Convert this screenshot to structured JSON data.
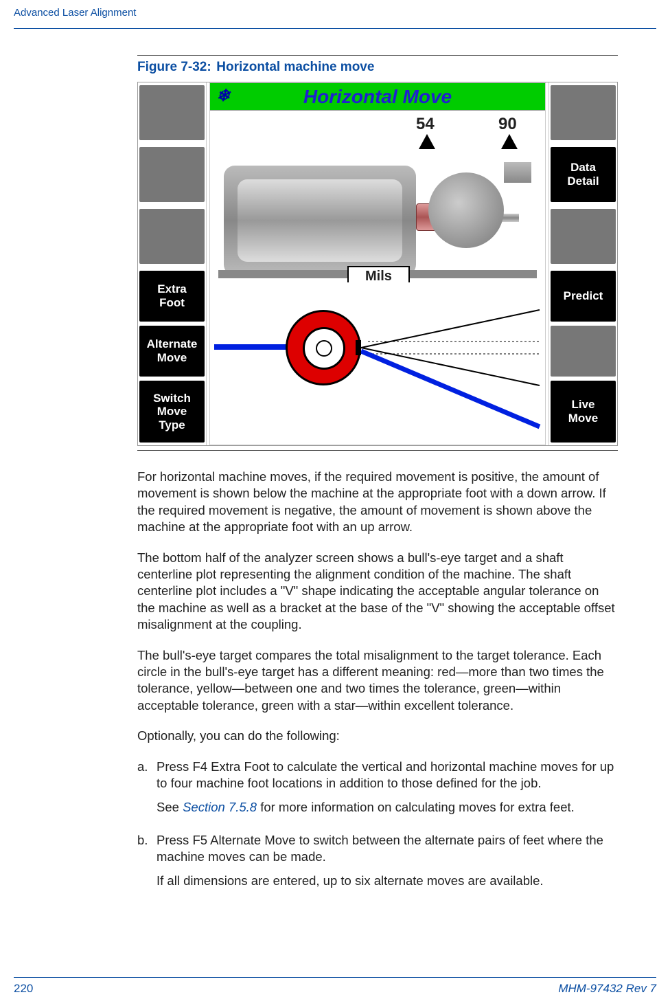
{
  "header": {
    "section_title": "Advanced Laser Alignment"
  },
  "figure": {
    "label": "Figure 7-32:",
    "title": "Horizontal machine move"
  },
  "analyzer": {
    "screen_title": "Horizontal Move",
    "value_left": "54",
    "value_right": "90",
    "units_label": "Mils",
    "left_buttons": {
      "extra_foot": "Extra\nFoot",
      "alternate_move": "Alternate\nMove",
      "switch_move_type": "Switch\nMove\nType"
    },
    "right_buttons": {
      "data_detail": "Data\nDetail",
      "predict": "Predict",
      "live_move": "Live\nMove"
    }
  },
  "paragraphs": {
    "p1": "For horizontal machine moves, if the required movement is positive, the amount of movement is shown below the machine at the appropriate foot with a down arrow. If the required movement is negative, the amount of movement is shown above the machine at the appropriate foot with an up arrow.",
    "p2": "The bottom half of the analyzer screen shows a bull's-eye target and a shaft centerline plot representing the alignment condition of the machine. The shaft centerline plot includes a \"V\" shape indicating the acceptable angular tolerance on the machine as well as a bracket at the base of the \"V\" showing the acceptable offset misalignment at the coupling.",
    "p3": "The bull's-eye target compares the total misalignment to the target tolerance. Each circle in the bull's-eye target has a different meaning: red—more than two times the tolerance, yellow—between one and two times the tolerance, green—within acceptable tolerance, green with a star—within excellent tolerance.",
    "p4": "Optionally, you can do the following:"
  },
  "list": {
    "a": {
      "marker": "a.",
      "pre": "Press ",
      "key": "F4 Extra Foot",
      "post": " to calculate the vertical and horizontal machine moves for up to four machine foot locations in addition to those defined for the job.",
      "note_pre": "See ",
      "note_link": "Section 7.5.8",
      "note_post": " for more information on calculating moves for extra feet."
    },
    "b": {
      "marker": "b.",
      "pre": "Press ",
      "key": "F5 Alternate Move",
      "post": " to switch between the alternate pairs of feet where the machine moves can be made.",
      "note": "If all dimensions are entered, up to six alternate moves are available."
    }
  },
  "footer": {
    "page": "220",
    "docid": "MHM-97432 Rev 7"
  }
}
